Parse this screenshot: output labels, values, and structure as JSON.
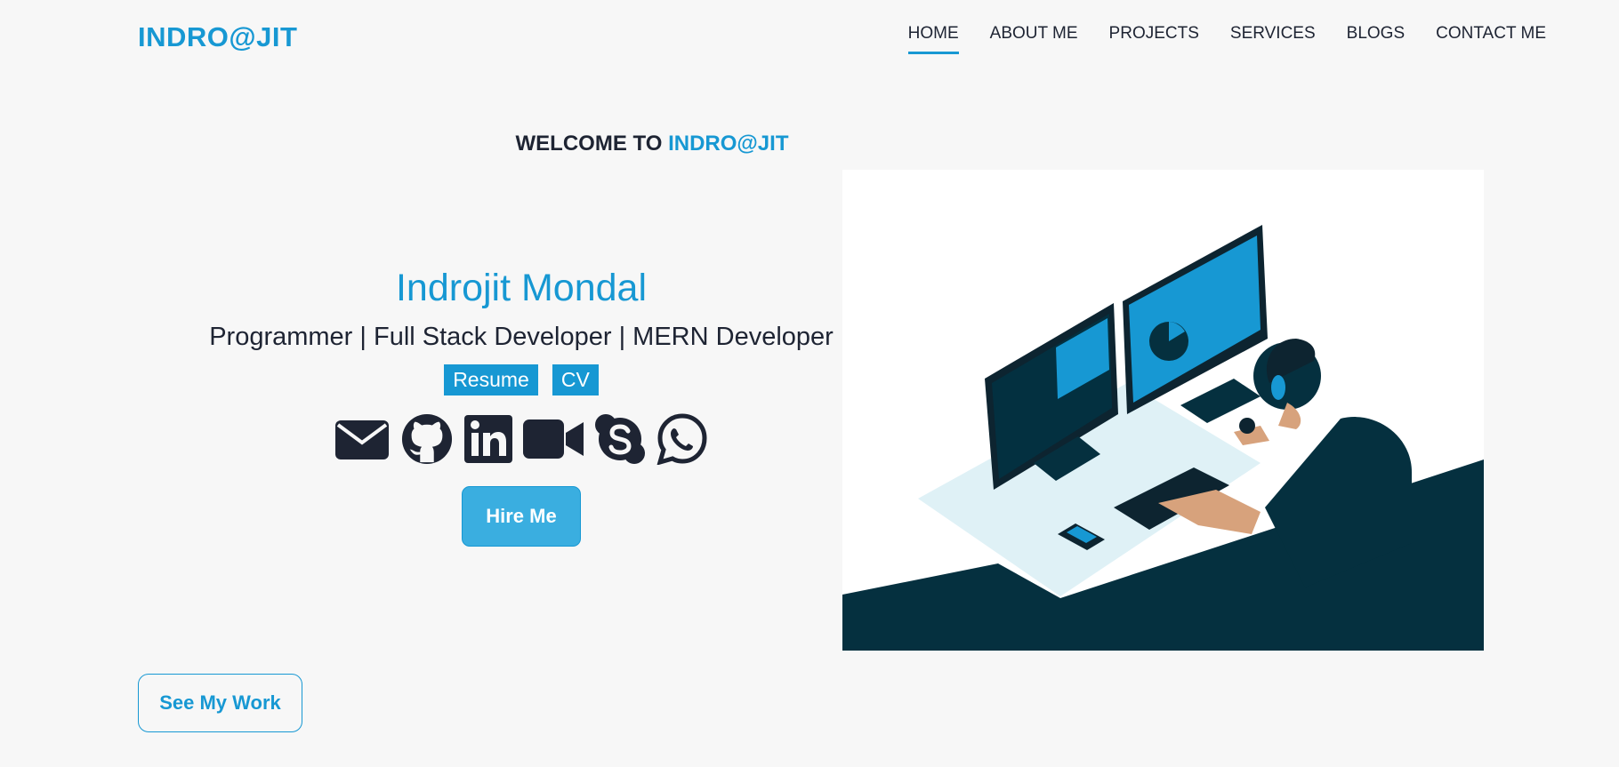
{
  "nav": {
    "logo": "INDRO@JIT",
    "items": [
      {
        "label": "HOME",
        "active": true
      },
      {
        "label": "ABOUT ME"
      },
      {
        "label": "PROJECTS"
      },
      {
        "label": "SERVICES"
      },
      {
        "label": "BLOGS"
      },
      {
        "label": "CONTACT ME"
      }
    ]
  },
  "welcome": {
    "prefix": "WELCOME TO",
    "brand": "INDRO@JIT"
  },
  "hero": {
    "name": "Indrojit Mondal",
    "roles": "Programmer | Full Stack Developer | MERN Developer",
    "resume_label": "Resume",
    "cv_label": "CV",
    "socials": [
      "envelope-icon",
      "github-icon",
      "linkedin-icon",
      "video-icon",
      "skype-icon",
      "whatsapp-icon"
    ],
    "hire_label": "Hire Me"
  },
  "see_work_label": "See My Work",
  "colors": {
    "accent": "#1798d3",
    "dark": "#1e2433",
    "illustration_dark": "#05303f",
    "background": "#f7f7f7"
  }
}
